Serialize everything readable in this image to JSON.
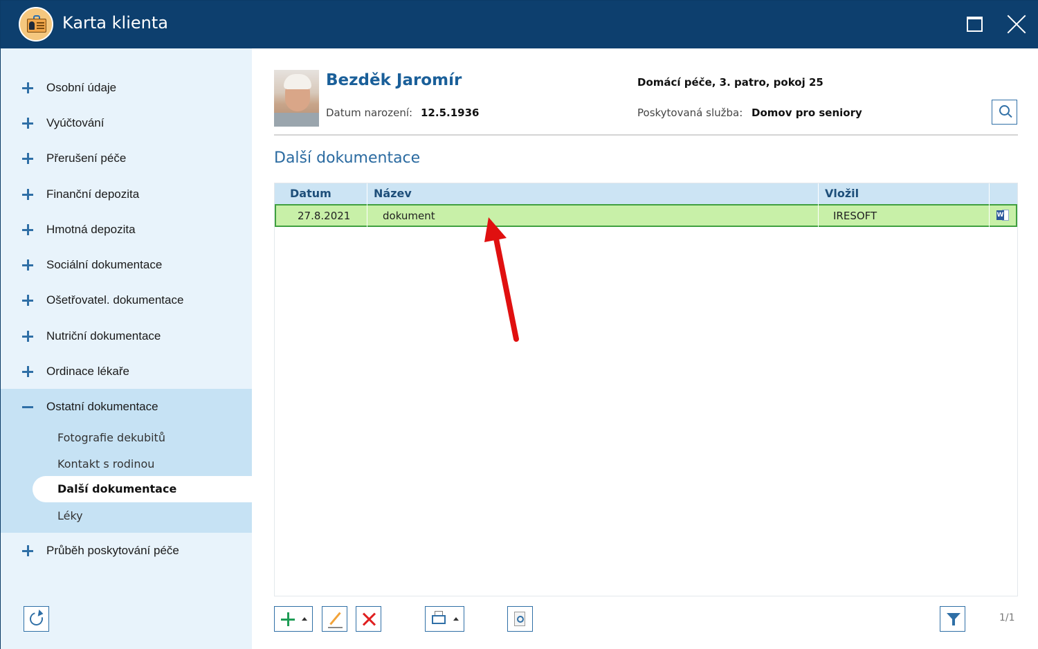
{
  "window": {
    "title": "Karta klienta"
  },
  "sidebar": {
    "items": [
      {
        "label": "Osobní údaje"
      },
      {
        "label": "Vyúčtování"
      },
      {
        "label": "Přerušení péče"
      },
      {
        "label": "Finanční depozita"
      },
      {
        "label": "Hmotná depozita"
      },
      {
        "label": "Sociální dokumentace"
      },
      {
        "label": "Ošetřovatel. dokumentace"
      },
      {
        "label": "Nutriční dokumentace"
      },
      {
        "label": "Ordinace lékaře"
      },
      {
        "label": "Ostatní dokumentace"
      },
      {
        "label": "Průběh poskytování péče"
      }
    ],
    "subitems": [
      {
        "label": "Fotografie dekubitů"
      },
      {
        "label": "Kontakt s rodinou"
      },
      {
        "label": "Další dokumentace"
      },
      {
        "label": "Léky"
      }
    ]
  },
  "client": {
    "name": "Bezděk Jaromír",
    "dob_label": "Datum narození:",
    "dob_value": "12.5.1936",
    "location": "Domácí péče, 3. patro, pokoj 25",
    "service_label": "Poskytovaná služba:",
    "service_value": "Domov pro seniory"
  },
  "section": {
    "title": "Další dokumentace"
  },
  "table": {
    "columns": [
      "Datum",
      "Název",
      "Vložil"
    ],
    "rows": [
      {
        "datum": "27.8.2021",
        "nazev": "dokument",
        "vlozil": "IRESOFT",
        "attachment_icon": "word-document-icon"
      }
    ]
  },
  "footer": {
    "page_indicator": "1/1"
  },
  "colors": {
    "titlebar": "#0d3f6e",
    "sidebar_bg": "#e8f3fb",
    "sidebar_expanded": "#c6e2f4",
    "accent": "#2f6fa6",
    "selected_row": "#c8f0a8",
    "selected_row_border": "#3f9f3f",
    "annotation_arrow": "#e01010"
  }
}
